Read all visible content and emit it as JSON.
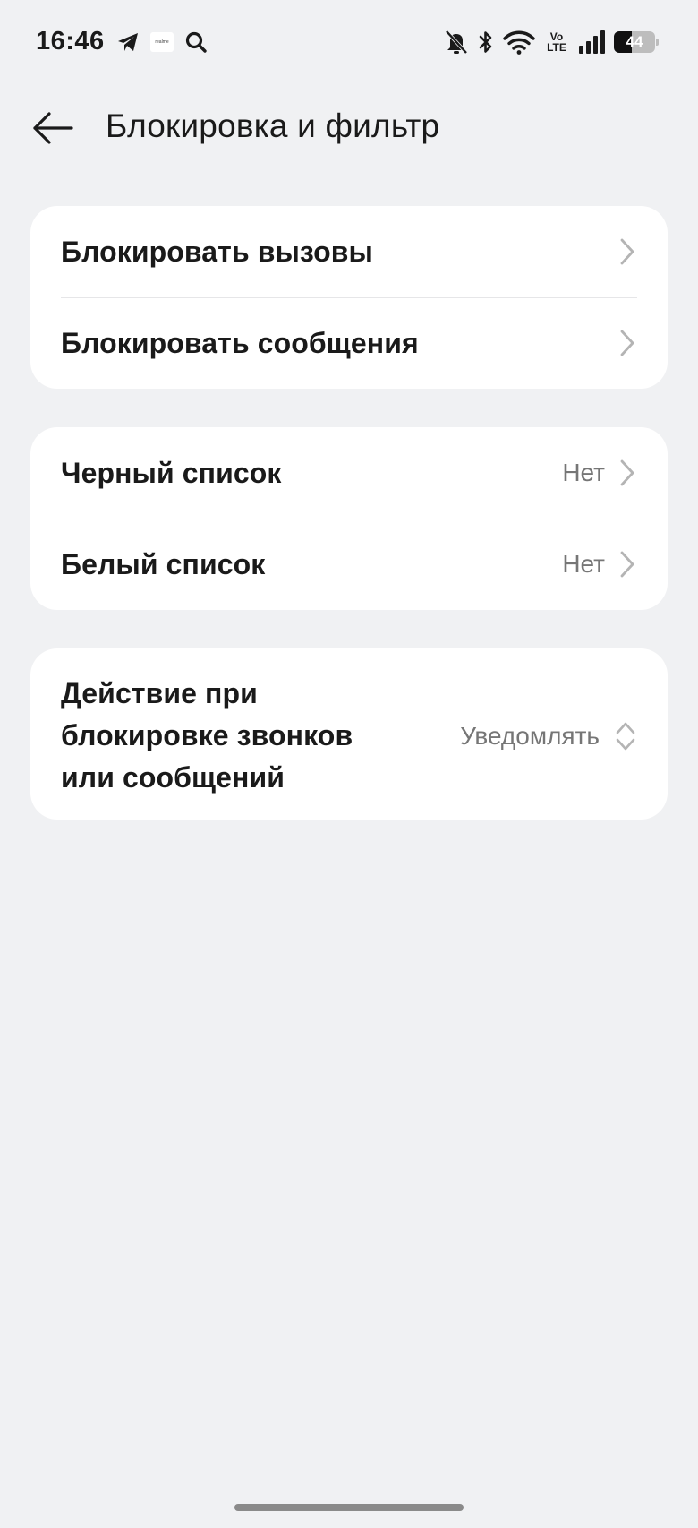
{
  "status_bar": {
    "time": "16:46",
    "notification_badge_text": "realme",
    "volte_top": "Vo",
    "volte_bottom": "LTE",
    "battery_level": "44",
    "icons": [
      "telegram-icon",
      "app-notification-icon",
      "search-icon",
      "bell-muted-icon",
      "bluetooth-icon",
      "wifi-icon",
      "volte-icon",
      "signal-icon",
      "battery-icon"
    ]
  },
  "header": {
    "title": "Блокировка и фильтр",
    "back_icon": "arrow-left-icon"
  },
  "groups": [
    {
      "items": [
        {
          "label": "Блокировать вызовы",
          "value": ""
        },
        {
          "label": "Блокировать сообщения",
          "value": ""
        }
      ]
    },
    {
      "items": [
        {
          "label": "Черный список",
          "value": "Нет"
        },
        {
          "label": "Белый список",
          "value": "Нет"
        }
      ]
    },
    {
      "items": [
        {
          "label": "Действие при блокировке звонков или сообщений",
          "value": "Уведомлять"
        }
      ]
    }
  ],
  "colors": {
    "background": "#f0f1f3",
    "card": "#ffffff",
    "text_primary": "#1a1a1a",
    "text_secondary": "#767676",
    "chevron": "#b4b4b4"
  }
}
